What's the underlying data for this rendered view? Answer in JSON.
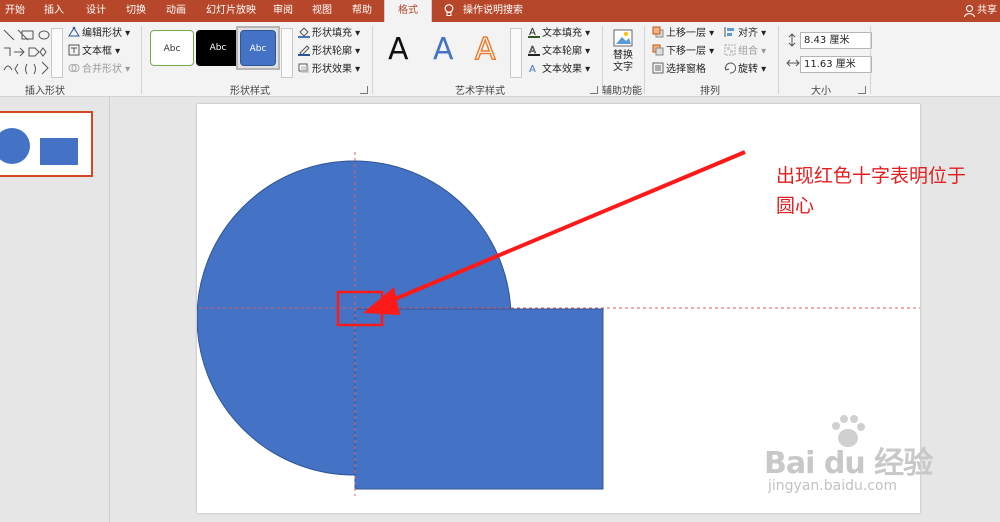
{
  "tabs": [
    "开始",
    "插入",
    "设计",
    "切换",
    "动画",
    "幻灯片放映",
    "审阅",
    "视图",
    "帮助",
    "格式"
  ],
  "active_tab": "格式",
  "tell_me": "操作说明搜索",
  "share": "共享",
  "groups": {
    "insert_shapes": {
      "label": "插入形状",
      "edit_shape": "编辑形状",
      "text_box": "文本框",
      "merge_shapes": "合并形状"
    },
    "shape_styles": {
      "label": "形状样式",
      "style_samples": [
        "Abc",
        "Abc",
        "Abc"
      ],
      "fill": "形状填充",
      "outline": "形状轮廓",
      "effects": "形状效果"
    },
    "wordart_styles": {
      "label": "艺术字样式",
      "samples": [
        "A",
        "A",
        "A"
      ],
      "text_fill": "文本填充",
      "text_outline": "文本轮廓",
      "text_effects": "文本效果"
    },
    "accessibility": {
      "label": "辅助功能",
      "alt_text_line1": "替换",
      "alt_text_line2": "文字"
    },
    "arrange": {
      "label": "排列",
      "bring_forward": "上移一层",
      "send_backward": "下移一层",
      "selection_pane": "选择窗格",
      "align": "对齐",
      "group": "组合",
      "rotate": "旋转"
    },
    "size": {
      "label": "大小",
      "height_value": "8.43 厘米",
      "width_value": "11.63 厘米"
    }
  },
  "annotation": {
    "line1": "出现红色十字表明位于",
    "line2": "圆心"
  },
  "watermark": {
    "brand": "Bai du 经验",
    "url": "jingyan.baidu.com"
  },
  "colors": {
    "ribbon_accent": "#b7472a",
    "shape_fill": "#4472c4",
    "annotation_red": "#e02020",
    "thumb_border": "#d24726"
  }
}
